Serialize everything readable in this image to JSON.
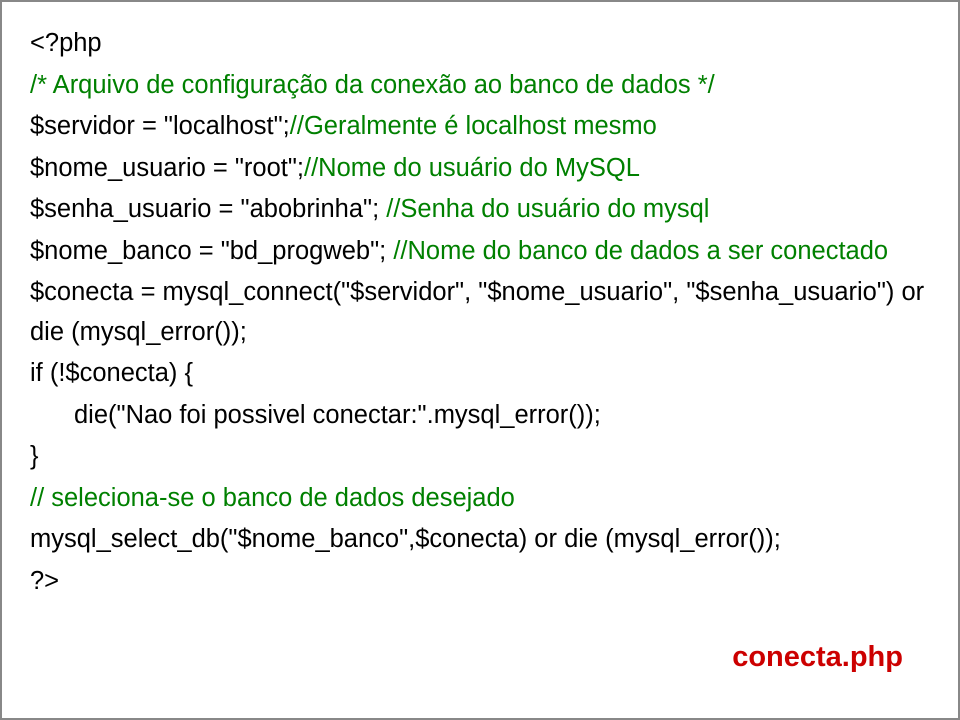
{
  "code": {
    "l1": "<?php",
    "l2": "/* Arquivo de configuração da conexão ao banco de dados */",
    "l3a": "$servidor = \"localhost\";",
    "l3b": "//Geralmente é localhost mesmo",
    "l4a": "$nome_usuario = \"root\";",
    "l4b": "//Nome do usuário do MySQL",
    "l5a": "$senha_usuario = \"abobrinha\"; ",
    "l5b": "//Senha do usuário do mysql",
    "l6a": "$nome_banco = \"bd_progweb\"; ",
    "l6b": "//Nome do banco de dados a ser conectado",
    "l7": "$conecta = mysql_connect(\"$servidor\", \"$nome_usuario\", \"$senha_usuario\") or die (mysql_error());",
    "l8": "if (!$conecta) {",
    "l9": "die(\"Nao foi possivel conectar:\".mysql_error());",
    "l10": "}",
    "l11": "// seleciona-se o banco de dados desejado",
    "l12": "mysql_select_db(\"$nome_banco\",$conecta) or die (mysql_error());",
    "l13": "?>"
  },
  "filename": "conecta.php"
}
